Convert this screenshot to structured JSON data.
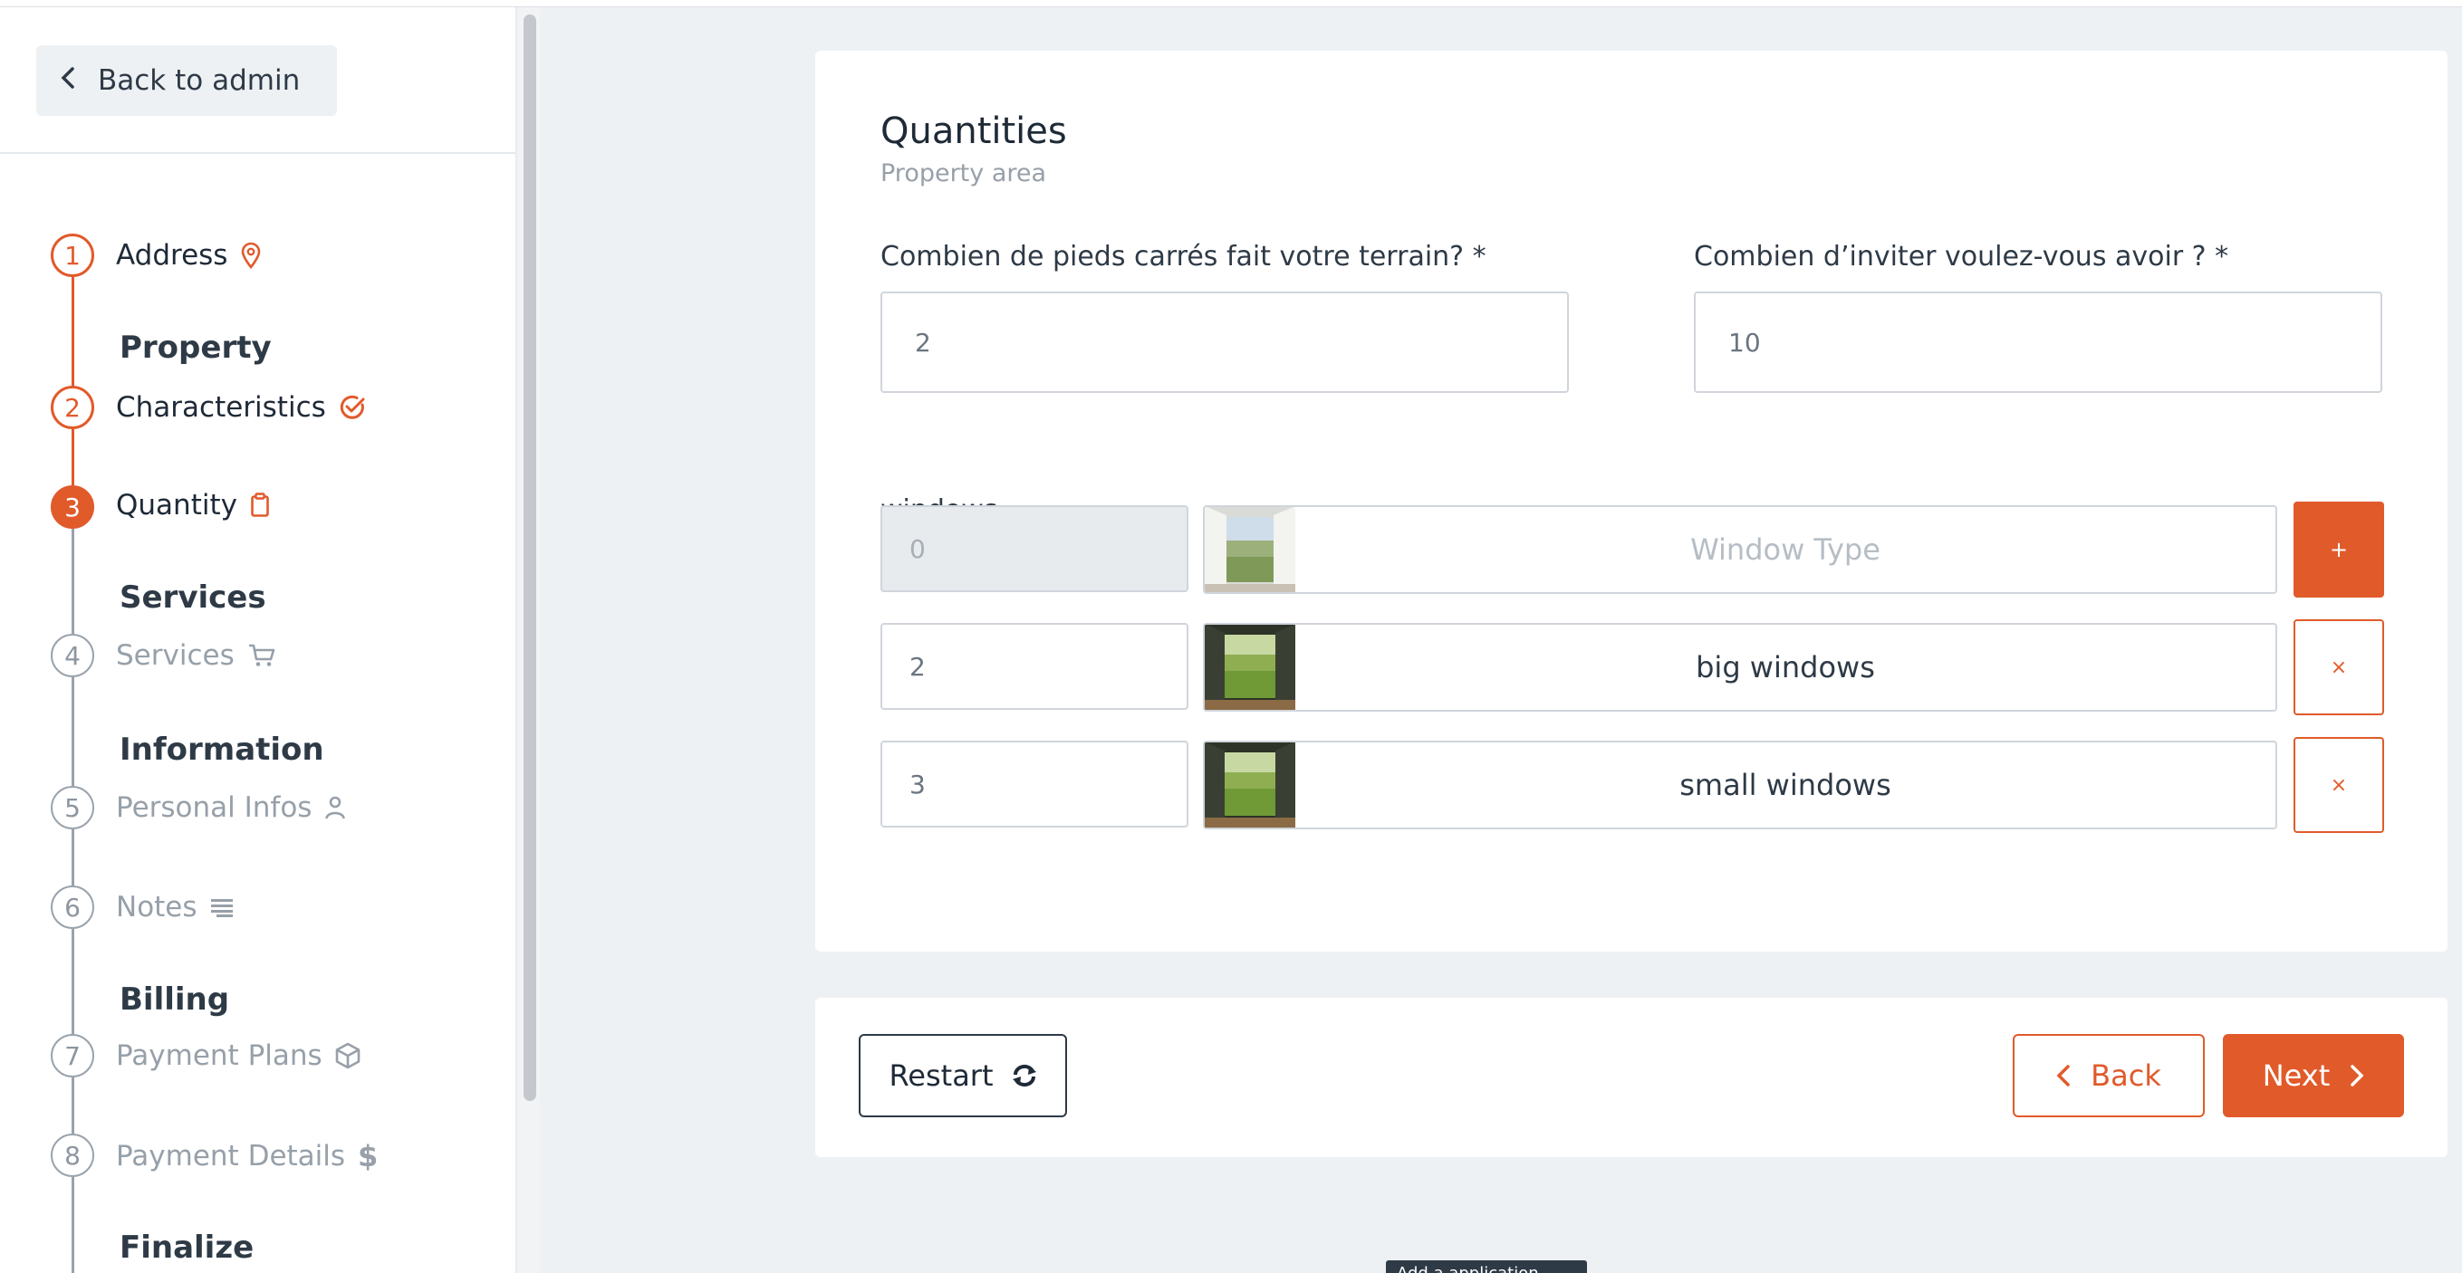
{
  "sidebar": {
    "back_label": "Back to admin",
    "sections": {
      "property": "Property",
      "services": "Services",
      "information": "Information",
      "billing": "Billing",
      "finalize": "Finalize"
    },
    "steps": [
      {
        "number": "1",
        "label": "Address",
        "state": "done",
        "icon": "map-pin-icon"
      },
      {
        "number": "2",
        "label": "Characteristics",
        "state": "done",
        "icon": "check-circle-icon"
      },
      {
        "number": "3",
        "label": "Quantity",
        "state": "current",
        "icon": "clipboard-icon"
      },
      {
        "number": "4",
        "label": "Services",
        "state": "pending",
        "icon": "cart-icon"
      },
      {
        "number": "5",
        "label": "Personal Infos",
        "state": "pending",
        "icon": "user-icon"
      },
      {
        "number": "6",
        "label": "Notes",
        "state": "pending",
        "icon": "lines-icon"
      },
      {
        "number": "7",
        "label": "Payment Plans",
        "state": "pending",
        "icon": "box-icon"
      },
      {
        "number": "8",
        "label": "Payment Details",
        "state": "pending",
        "icon": "dollar-icon"
      }
    ]
  },
  "main": {
    "title": "Quantities",
    "subtitle": "Property area",
    "field1": {
      "label": "Combien de pieds carrés fait votre terrain? *",
      "value": "2"
    },
    "field2": {
      "label": "Combien d’inviter voulez-vous avoir ? *",
      "value": "10"
    },
    "windows": {
      "label": "windows",
      "new_row": {
        "quantity": "0",
        "type_placeholder": "Window Type",
        "add_label": "+"
      },
      "rows": [
        {
          "quantity": "2",
          "type": "big windows",
          "remove_label": "×"
        },
        {
          "quantity": "3",
          "type": "small windows",
          "remove_label": "×"
        }
      ]
    }
  },
  "footer": {
    "restart_label": "Restart",
    "back_label": "Back",
    "next_label": "Next"
  },
  "tooltip": "Add a application",
  "colors": {
    "accent": "#e15a2a",
    "background": "#eef1f4",
    "muted": "#97a0a9"
  }
}
